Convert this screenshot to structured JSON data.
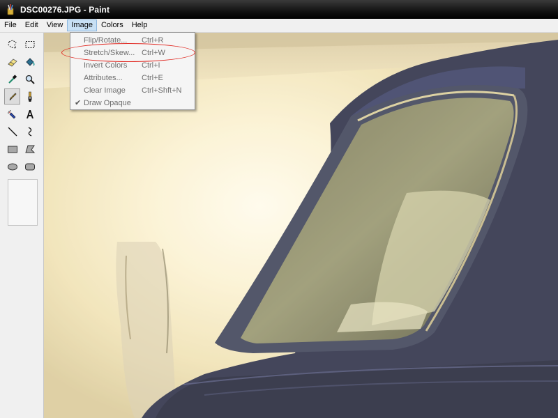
{
  "window": {
    "title": "DSC00276.JPG - Paint",
    "app_icon": "paint-brush-cup-icon"
  },
  "menubar": {
    "items": [
      "File",
      "Edit",
      "View",
      "Image",
      "Colors",
      "Help"
    ],
    "active": "Image"
  },
  "toolbox": {
    "tools": [
      {
        "name": "free-form-select",
        "icon": "free-form-select-icon"
      },
      {
        "name": "rect-select",
        "icon": "rect-select-icon"
      },
      {
        "name": "eraser",
        "icon": "eraser-icon"
      },
      {
        "name": "fill",
        "icon": "fill-bucket-icon"
      },
      {
        "name": "pick-color",
        "icon": "eyedropper-icon"
      },
      {
        "name": "magnifier",
        "icon": "magnifier-icon"
      },
      {
        "name": "pencil",
        "icon": "pencil-icon",
        "selected": true
      },
      {
        "name": "brush",
        "icon": "brush-icon"
      },
      {
        "name": "airbrush",
        "icon": "airbrush-icon"
      },
      {
        "name": "text",
        "icon": "text-icon"
      },
      {
        "name": "line",
        "icon": "line-icon"
      },
      {
        "name": "curve",
        "icon": "curve-icon"
      },
      {
        "name": "rectangle",
        "icon": "rectangle-icon"
      },
      {
        "name": "polygon",
        "icon": "polygon-icon"
      },
      {
        "name": "ellipse",
        "icon": "ellipse-icon"
      },
      {
        "name": "rounded-rectangle",
        "icon": "rounded-rectangle-icon"
      }
    ]
  },
  "image_menu": {
    "items": [
      {
        "label": "Flip/Rotate...",
        "shortcut": "Ctrl+R",
        "checked": false
      },
      {
        "label": "Stretch/Skew...",
        "shortcut": "Ctrl+W",
        "checked": false,
        "circled": true
      },
      {
        "label": "Invert Colors",
        "shortcut": "Ctrl+I",
        "checked": false
      },
      {
        "label": "Attributes...",
        "shortcut": "Ctrl+E",
        "checked": false
      },
      {
        "label": "Clear Image",
        "shortcut": "Ctrl+Shft+N",
        "checked": false
      },
      {
        "label": "Draw Opaque",
        "shortcut": "",
        "checked": true
      }
    ],
    "check_glyph": "✔"
  },
  "colors": {
    "highlight_ellipse": "#e0241d",
    "menu_active_bg": "#c8e0f4",
    "disabled_text": "#6d6d6d"
  }
}
